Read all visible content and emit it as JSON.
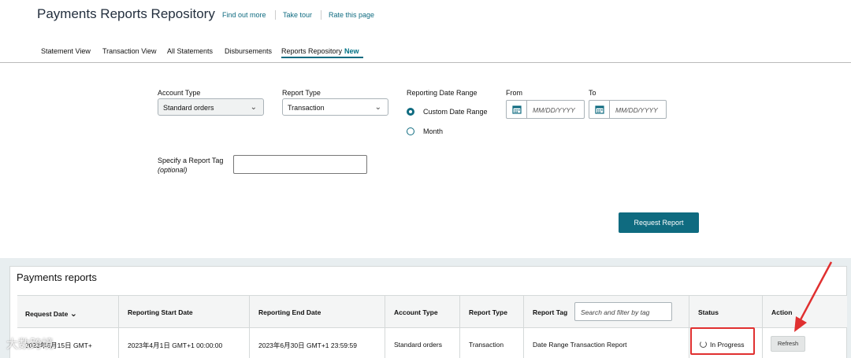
{
  "header": {
    "title": "Payments Reports Repository",
    "links": [
      "Find out more",
      "Take tour",
      "Rate this page"
    ]
  },
  "tabs": [
    {
      "label": "Statement View"
    },
    {
      "label": "Transaction View"
    },
    {
      "label": "All Statements"
    },
    {
      "label": "Disbursements"
    },
    {
      "label": "Reports Repository",
      "badge": "New",
      "active": true
    }
  ],
  "form": {
    "account_type_label": "Account Type",
    "account_type_value": "Standard orders",
    "report_type_label": "Report Type",
    "report_type_value": "Transaction",
    "date_range_label": "Reporting Date Range",
    "option_custom": "Custom Date Range",
    "option_month": "Month",
    "from_label": "From",
    "to_label": "To",
    "date_placeholder": "MM/DD/YYYY",
    "tag_label": "Specify a Report Tag",
    "tag_optional": "(optional)",
    "request_button": "Request Report"
  },
  "reports": {
    "title": "Payments reports",
    "columns": [
      "Request Date",
      "Reporting Start Date",
      "Reporting End Date",
      "Account Type",
      "Report Type",
      "Report Tag",
      "Status",
      "Action"
    ],
    "filter_placeholder": "Search and filter by tag",
    "row": {
      "request_date": "2023年6月15日 GMT+",
      "start": "2023年4月1日 GMT+1 00:00:00",
      "end": "2023年6月30日 GMT+1 23:59:59",
      "account_type": "Standard orders",
      "report_type": "Transaction",
      "report_tag": "Date Range Transaction Report",
      "status": "In Progress",
      "action": "Refresh"
    }
  },
  "watermark": "大数跨境",
  "colors": {
    "accent": "#0f6b80",
    "highlight": "#e03030"
  }
}
